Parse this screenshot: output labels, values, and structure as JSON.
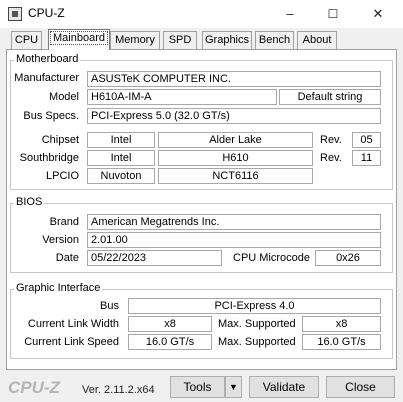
{
  "window": {
    "title": "CPU-Z",
    "minimize": "–",
    "maximize": "☐",
    "close": "✕"
  },
  "tabs": [
    {
      "label": "CPU"
    },
    {
      "label": "Mainboard"
    },
    {
      "label": "Memory"
    },
    {
      "label": "SPD"
    },
    {
      "label": "Graphics"
    },
    {
      "label": "Bench"
    },
    {
      "label": "About"
    }
  ],
  "motherboard": {
    "title": "Motherboard",
    "manufacturer_label": "Manufacturer",
    "manufacturer": "ASUSTeK COMPUTER INC.",
    "model_label": "Model",
    "model": "H610A-IM-A",
    "model_extra": "Default string",
    "bus_label": "Bus Specs.",
    "bus": "PCI-Express 5.0 (32.0 GT/s)",
    "chipset_label": "Chipset",
    "chipset_vendor": "Intel",
    "chipset_name": "Alder Lake",
    "chipset_rev_label": "Rev.",
    "chipset_rev": "05",
    "southbridge_label": "Southbridge",
    "southbridge_vendor": "Intel",
    "southbridge_name": "H610",
    "southbridge_rev_label": "Rev.",
    "southbridge_rev": "11",
    "lpcio_label": "LPCIO",
    "lpcio_vendor": "Nuvoton",
    "lpcio_name": "NCT6116"
  },
  "bios": {
    "title": "BIOS",
    "brand_label": "Brand",
    "brand": "American Megatrends Inc.",
    "version_label": "Version",
    "version": "2.01.00",
    "date_label": "Date",
    "date": "05/22/2023",
    "microcode_label": "CPU Microcode",
    "microcode": "0x26"
  },
  "graphic": {
    "title": "Graphic Interface",
    "bus_label": "Bus",
    "bus": "PCI-Express 4.0",
    "link_width_label": "Current Link Width",
    "link_width": "x8",
    "max_width_label": "Max. Supported",
    "max_width": "x8",
    "link_speed_label": "Current Link Speed",
    "link_speed": "16.0 GT/s",
    "max_speed_label": "Max. Supported",
    "max_speed": "16.0 GT/s"
  },
  "footer": {
    "logo": "CPU-Z",
    "version": "Ver. 2.11.2.x64",
    "tools_label": "Tools",
    "tools_arrow": "▼",
    "validate_label": "Validate",
    "close_label": "Close"
  }
}
